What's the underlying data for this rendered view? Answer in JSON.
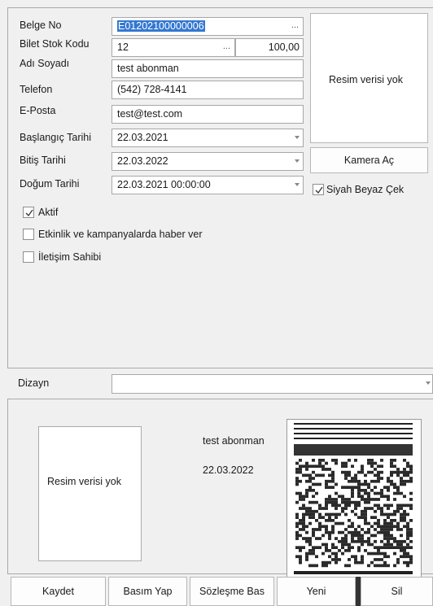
{
  "form": {
    "belge_no": {
      "label": "Belge No",
      "value": "E01202100000006"
    },
    "bilet_stok_kodu": {
      "label": "Bilet Stok Kodu",
      "value": "12",
      "amount": "100,00"
    },
    "adi_soyadi": {
      "label": "Adı Soyadı",
      "value": "test abonman"
    },
    "telefon": {
      "label": "Telefon",
      "value": "(542) 728-4141"
    },
    "eposta": {
      "label": "E-Posta",
      "value": "test@test.com"
    },
    "baslangic_tarihi": {
      "label": "Başlangıç Tarihi",
      "value": "22.03.2021"
    },
    "bitis_tarihi": {
      "label": "Bitiş Tarihi",
      "value": "22.03.2022"
    },
    "dogum_tarihi": {
      "label": "Doğum Tarihi",
      "value": "22.03.2021 00:00:00"
    }
  },
  "photo_panel": {
    "placeholder": "Resim verisi yok"
  },
  "camera_button": {
    "label": "Kamera Aç"
  },
  "siyah_beyaz": {
    "label": "Siyah Beyaz Çek",
    "checked": true
  },
  "checkboxes": {
    "aktif": {
      "label": "Aktif",
      "checked": true
    },
    "etkinlik": {
      "label": "Etkinlik ve kampanyalarda haber ver",
      "checked": false
    },
    "iletisim": {
      "label": "İletişim Sahibi",
      "checked": false
    }
  },
  "dizayn": {
    "label": "Dizayn",
    "value": ""
  },
  "preview": {
    "photo_placeholder": "Resim verisi yok",
    "name": "test abonman",
    "date": "22.03.2022"
  },
  "buttons": {
    "kaydet": "Kaydet",
    "basim_yap": "Basım Yap",
    "sozlesme_bas": "Sözleşme Bas",
    "yeni": "Yeni",
    "sil": "Sil"
  },
  "ellipsis": "..."
}
